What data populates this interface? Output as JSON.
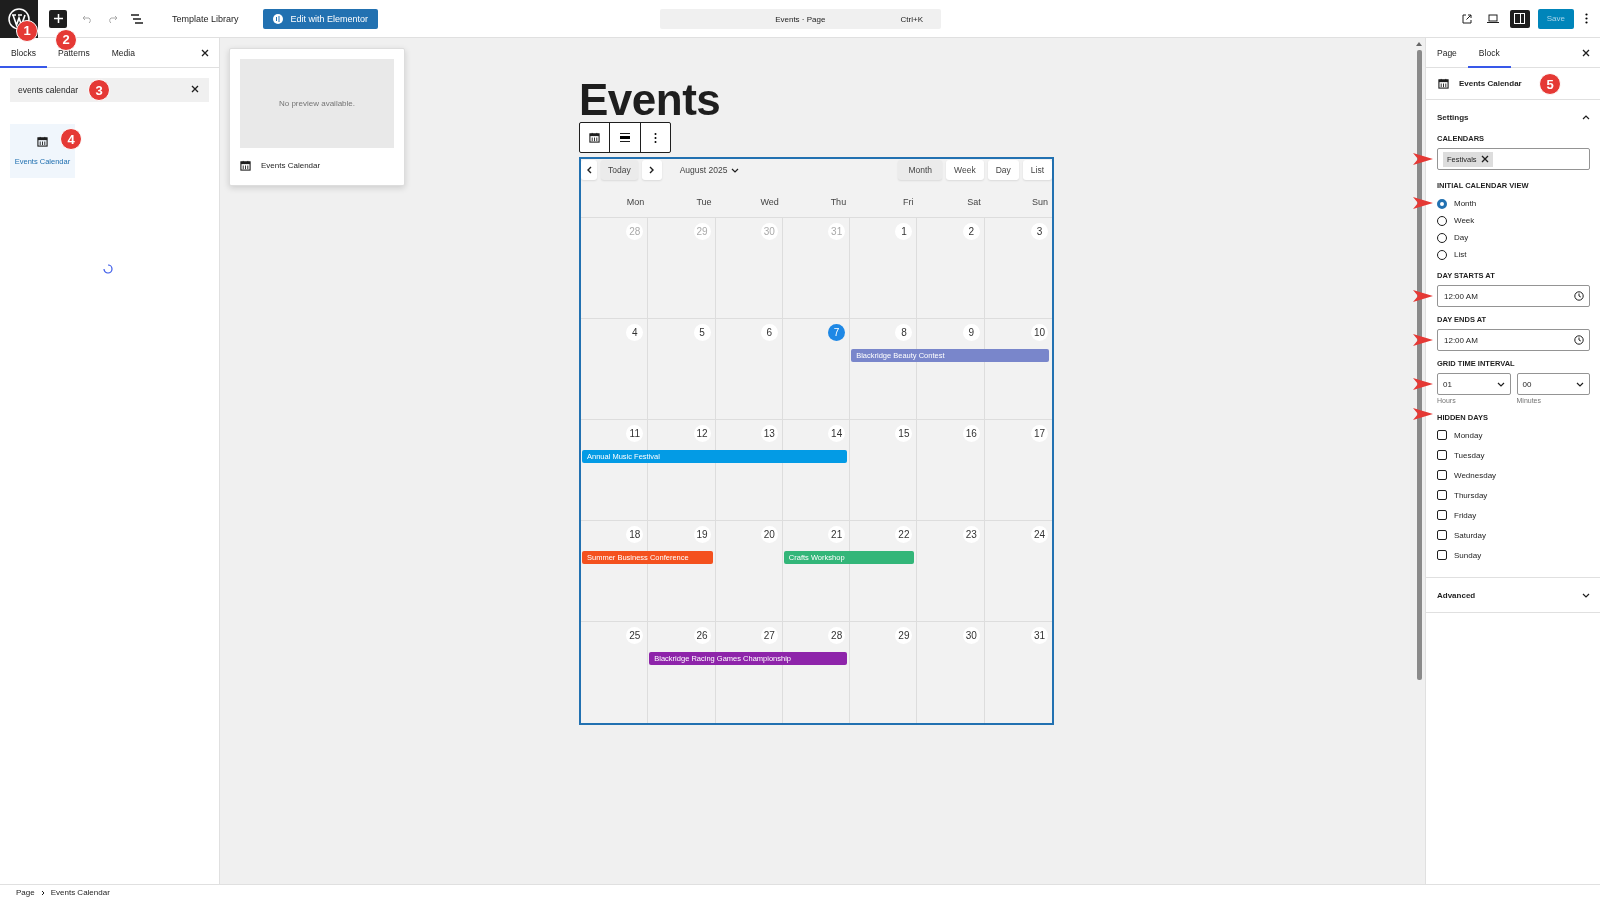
{
  "topbar": {
    "template_library": "Template Library",
    "elementor_button": "Edit with Elementor",
    "command_title": "Events · Page",
    "command_shortcut": "Ctrl+K",
    "save": "Save",
    "sidebar_toggle_on": true
  },
  "inserter": {
    "tabs": [
      {
        "label": "Blocks",
        "selected": true
      },
      {
        "label": "Patterns",
        "selected": false
      },
      {
        "label": "Media",
        "selected": false
      }
    ],
    "search": {
      "value": "events calendar"
    },
    "results": [
      {
        "label": "Events Calendar",
        "selected": true
      }
    ],
    "loading": true
  },
  "preview": {
    "message": "No preview available.",
    "title": "Events Calendar"
  },
  "page": {
    "title": "Events"
  },
  "calendar": {
    "month": "August 2025",
    "today_button": "Today",
    "views": [
      {
        "label": "Month",
        "selected": true
      },
      {
        "label": "Week",
        "selected": false
      },
      {
        "label": "Day",
        "selected": false
      },
      {
        "label": "List",
        "selected": false
      }
    ],
    "weekdays": [
      "Mon",
      "Tue",
      "Wed",
      "Thu",
      "Fri",
      "Sat",
      "Sun"
    ],
    "weeks": [
      {
        "days": [
          {
            "date": "28",
            "muted": true
          },
          {
            "date": "29",
            "muted": true
          },
          {
            "date": "30",
            "muted": true
          },
          {
            "date": "31",
            "muted": true
          },
          {
            "date": "1",
            "muted": false
          },
          {
            "date": "2",
            "muted": false
          },
          {
            "date": "3",
            "muted": false
          }
        ]
      },
      {
        "days": [
          {
            "date": "4",
            "muted": false
          },
          {
            "date": "5",
            "muted": false
          },
          {
            "date": "6",
            "muted": false
          },
          {
            "date": "7",
            "muted": false,
            "today": true
          },
          {
            "date": "8",
            "muted": false,
            "event": {
              "title": "Blackridge Beauty Contest",
              "color": "#7986cb"
            }
          },
          {
            "date": "9",
            "muted": false,
            "event_continues": true
          },
          {
            "date": "10",
            "muted": false,
            "event_continues": true
          }
        ]
      },
      {
        "days": [
          {
            "date": "11",
            "muted": false,
            "event": {
              "title": "Annual Music Festival",
              "color": "#039be5"
            }
          },
          {
            "date": "12",
            "muted": false,
            "event_continues": true
          },
          {
            "date": "13",
            "muted": false,
            "event_continues": true
          },
          {
            "date": "14",
            "muted": false,
            "event_continues": true
          },
          {
            "date": "15",
            "muted": false
          },
          {
            "date": "16",
            "muted": false
          },
          {
            "date": "17",
            "muted": false
          }
        ]
      },
      {
        "days": [
          {
            "date": "18",
            "muted": false,
            "event": {
              "title": "Summer Business Conference",
              "color": "#f4511e"
            }
          },
          {
            "date": "19",
            "muted": false,
            "event_continues": true
          },
          {
            "date": "20",
            "muted": false
          },
          {
            "date": "21",
            "muted": false,
            "event": {
              "title": "Crafts Workshop",
              "color": "#33b679"
            }
          },
          {
            "date": "22",
            "muted": false,
            "event_continues": true
          },
          {
            "date": "23",
            "muted": false
          },
          {
            "date": "24",
            "muted": false
          }
        ]
      },
      {
        "days": [
          {
            "date": "25",
            "muted": false
          },
          {
            "date": "26",
            "muted": false,
            "event": {
              "title": "Blackridge Racing Games Championship",
              "color": "#8e24aa"
            }
          },
          {
            "date": "27",
            "muted": false,
            "event_continues": true
          },
          {
            "date": "28",
            "muted": false,
            "event_continues": true
          },
          {
            "date": "29",
            "muted": false
          },
          {
            "date": "30",
            "muted": false
          },
          {
            "date": "31",
            "muted": false
          }
        ]
      }
    ]
  },
  "settings_panel": {
    "tabs": [
      {
        "label": "Page",
        "selected": false
      },
      {
        "label": "Block",
        "selected": true
      }
    ],
    "block_title": "Events Calendar",
    "settings_heading": "Settings",
    "settings_expanded": true,
    "calendars": {
      "label": "CALENDARS",
      "tags": [
        "Festivals"
      ]
    },
    "initial_view": {
      "label": "INITIAL CALENDAR VIEW",
      "options": [
        {
          "label": "Month",
          "selected": true
        },
        {
          "label": "Week",
          "selected": false
        },
        {
          "label": "Day",
          "selected": false
        },
        {
          "label": "List",
          "selected": false
        }
      ]
    },
    "day_starts": {
      "label": "DAY STARTS AT",
      "value": "12:00 AM"
    },
    "day_ends": {
      "label": "DAY ENDS AT",
      "value": "12:00 AM"
    },
    "grid_interval": {
      "label": "GRID TIME INTERVAL",
      "hours": "01",
      "minutes": "00",
      "hours_label": "Hours",
      "minutes_label": "Minutes"
    },
    "hidden_days": {
      "label": "HIDDEN DAYS",
      "days": [
        {
          "label": "Monday",
          "checked": false
        },
        {
          "label": "Tuesday",
          "checked": false
        },
        {
          "label": "Wednesday",
          "checked": false
        },
        {
          "label": "Thursday",
          "checked": false
        },
        {
          "label": "Friday",
          "checked": false
        },
        {
          "label": "Saturday",
          "checked": false
        },
        {
          "label": "Sunday",
          "checked": false
        }
      ]
    },
    "advanced_heading": "Advanced",
    "advanced_expanded": false
  },
  "breadcrumb": [
    "Page",
    "Events Calendar"
  ],
  "step_markers": {
    "logo": "1",
    "inserter": "2",
    "search": "3",
    "result": "4",
    "block_title": "5"
  }
}
